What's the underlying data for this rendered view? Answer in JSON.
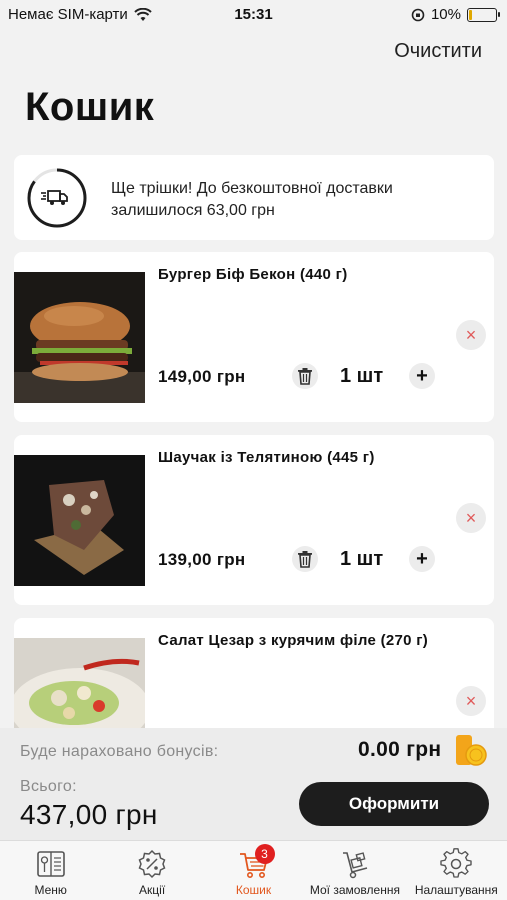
{
  "status_bar": {
    "carrier": "Немає SIM-карти",
    "time": "15:31",
    "battery": "10%",
    "battery_level": 0.1
  },
  "header": {
    "clear_label": "Очистити",
    "title": "Кошик"
  },
  "delivery": {
    "message": "Ще трішки! До безкоштовної доставки залишилося 63,00 грн",
    "progress": 0.85
  },
  "cart": {
    "items": [
      {
        "name": "Бургер Біф Бекон (440 г)",
        "price": "149,00 грн",
        "qty": "1 шт",
        "remove": "×"
      },
      {
        "name": "Шаучак із Телятиною (445 г)",
        "price": "139,00 грн",
        "qty": "1 шт",
        "remove": "×"
      },
      {
        "name": "Салат Цезар з курячим філе (270 г)",
        "remove": "×"
      }
    ]
  },
  "summary": {
    "bonus_label": "Буде нараховано бонусів:",
    "bonus_value": "0.00 грн",
    "total_label": "Всього:",
    "total_value": "437,00 грн",
    "checkout_label": "Оформити"
  },
  "tabs": [
    {
      "label": "Меню",
      "icon": "menu-book-icon"
    },
    {
      "label": "Акції",
      "icon": "discount-badge-icon"
    },
    {
      "label": "Кошик",
      "icon": "cart-icon",
      "badge": "3",
      "active": true
    },
    {
      "label": "Мої замовлення",
      "icon": "hand-truck-icon"
    },
    {
      "label": "Налаштування",
      "icon": "gear-icon"
    }
  ],
  "colors": {
    "accent": "#e2571e",
    "badge": "#e02020",
    "remove": "#e05a5a",
    "checkout": "#1d1d1d"
  }
}
